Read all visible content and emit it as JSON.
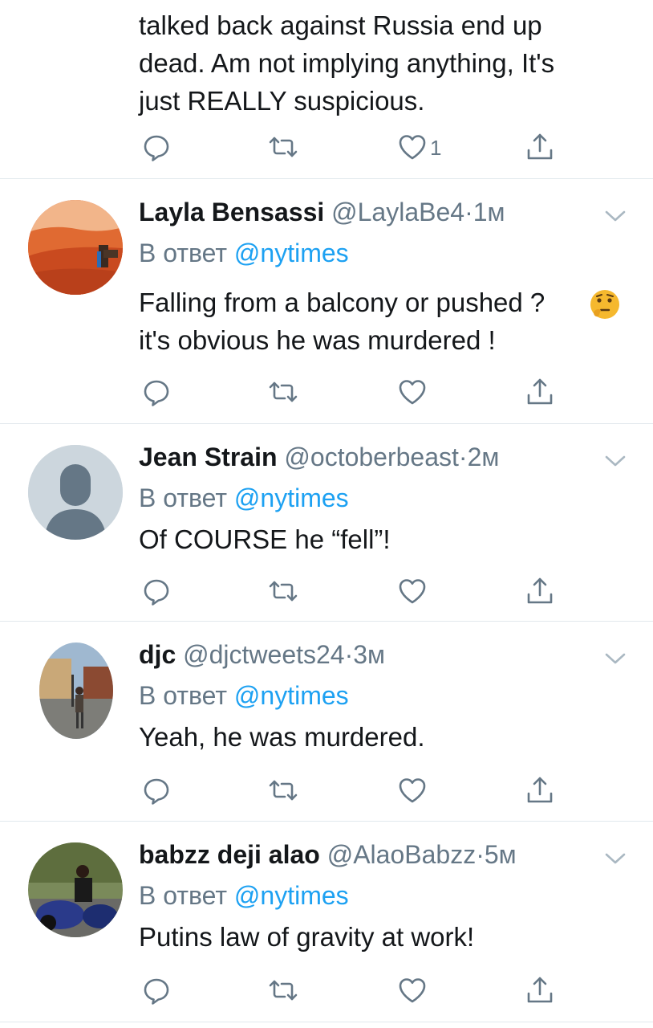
{
  "tweets": [
    {
      "text": "talked back against Russia end up\ndead. Am not implying anything, It's\njust REALLY suspicious.",
      "like_count": "1"
    },
    {
      "name": "Layla Bensassi",
      "handle": "@LaylaBe4",
      "dot": "·",
      "time": "1м",
      "reply_prefix": "В ответ",
      "reply_to": "@nytimes",
      "text": "Falling from a balcony or pushed ?\nit's obvious he was murdered !",
      "avatar": "desert-camel-photo"
    },
    {
      "name": "Jean Strain",
      "handle": "@octoberbeast",
      "dot": "·",
      "time": "2м",
      "reply_prefix": "В ответ",
      "reply_to": "@nytimes",
      "text": "Of COURSE he “fell”!",
      "avatar": "default-user-silhouette"
    },
    {
      "name": "djc",
      "handle": "@djctweets24",
      "dot": "·",
      "time": "3м",
      "reply_prefix": "В ответ",
      "reply_to": "@nytimes",
      "text": "Yeah, he was murdered.",
      "avatar": "street-photo"
    },
    {
      "name": "babzz deji alao",
      "handle": "@AlaoBabzz",
      "dot": "·",
      "time": "5м",
      "reply_prefix": "В ответ",
      "reply_to": "@nytimes",
      "text": "Putins law of gravity at work!",
      "avatar": "motorcycle-photo"
    }
  ],
  "colors": {
    "accent": "#1da1f2",
    "secondary_text": "#657786",
    "separator": "#e1e8ed"
  }
}
